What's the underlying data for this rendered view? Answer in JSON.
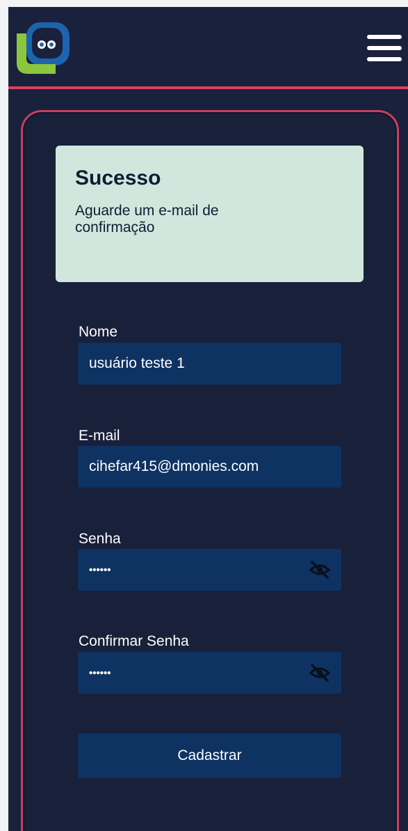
{
  "header": {
    "logo_icon": "app-logo",
    "menu_icon": "hamburger-menu-icon"
  },
  "alert": {
    "title": "Sucesso",
    "message": "Aguarde um e-mail de confirmação",
    "background": "#d1e7dd"
  },
  "form": {
    "name": {
      "label": "Nome",
      "value": "usuário teste 1"
    },
    "email": {
      "label": "E-mail",
      "value": "cihefar415@dmonies.com"
    },
    "password": {
      "label": "Senha",
      "value": "••••••",
      "toggle_icon": "eye-slash-icon"
    },
    "confirm_password": {
      "label": "Confirmar Senha",
      "value": "••••••",
      "toggle_icon": "eye-slash-icon"
    },
    "submit_label": "Cadastrar"
  },
  "colors": {
    "background": "#1a213d",
    "accent": "#d9415b",
    "field": "#0e3262"
  }
}
